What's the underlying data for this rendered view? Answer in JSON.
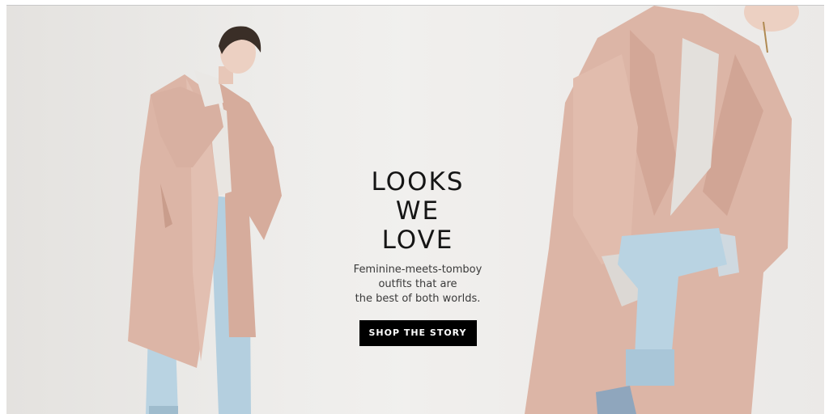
{
  "hero": {
    "headline_line1": "LOOKS",
    "headline_line2": "WE",
    "headline_line3": "LOVE",
    "sub_line1": "Feminine-meets-tomboy",
    "sub_line2": "outfits that are",
    "sub_line3": "the best of both worlds.",
    "cta_label": "SHOP THE STORY"
  },
  "colors": {
    "coat": "#dcb5a6",
    "denim": "#b9d3e2",
    "background": "#eeedeb",
    "cta_background": "#000000",
    "cta_text": "#ffffff"
  }
}
